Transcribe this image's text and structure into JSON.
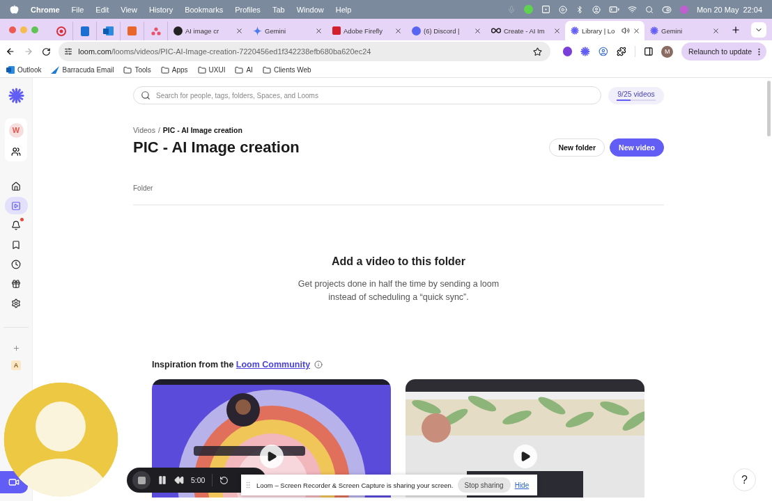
{
  "menu_bar": {
    "app": "Chrome",
    "menus": [
      "File",
      "Edit",
      "View",
      "History",
      "Bookmarks",
      "Profiles",
      "Tab",
      "Window",
      "Help"
    ],
    "date": "Mon 20 May",
    "time": "22:04"
  },
  "tabs": [
    {
      "kind": "pinned",
      "selected": false
    },
    {
      "kind": "pinned",
      "selected": false
    },
    {
      "kind": "pinned",
      "selected": false
    },
    {
      "kind": "pinned",
      "selected": false
    },
    {
      "kind": "pinned",
      "selected": false
    },
    {
      "kind": "normal",
      "title": "AI image cr",
      "selected": false,
      "audio": false
    },
    {
      "kind": "normal",
      "title": "Gemini",
      "selected": false,
      "audio": false
    },
    {
      "kind": "normal",
      "title": "Adobe Firefly",
      "selected": false,
      "audio": false
    },
    {
      "kind": "normal",
      "title": "(6) Discord |",
      "selected": false,
      "audio": false
    },
    {
      "kind": "normal",
      "title": "Create - AI Im",
      "selected": false,
      "audio": false
    },
    {
      "kind": "normal",
      "title": "Library | Lo",
      "selected": true,
      "audio": true
    },
    {
      "kind": "normal",
      "title": "Gemini",
      "selected": false,
      "audio": false
    }
  ],
  "address_bar": {
    "host": "loom.com",
    "path": "/looms/videos/PIC-AI-Image-creation-7220456ed1f342238efb680ba620ec24",
    "profile": "M",
    "relaunch": "Relaunch to update"
  },
  "bookmarks": [
    {
      "kind": "link",
      "label": "Outlook"
    },
    {
      "kind": "link",
      "label": "Barracuda Email"
    },
    {
      "kind": "folder",
      "label": "Tools"
    },
    {
      "kind": "folder",
      "label": "Apps"
    },
    {
      "kind": "folder",
      "label": "UXUI"
    },
    {
      "kind": "folder",
      "label": "AI"
    },
    {
      "kind": "folder",
      "label": "Clients Web"
    }
  ],
  "sidebar": {
    "workspace": "W",
    "nav": [
      {
        "selected": false,
        "badge": false
      },
      {
        "selected": true,
        "badge": false
      },
      {
        "selected": false,
        "badge": true
      },
      {
        "selected": false,
        "badge": false
      },
      {
        "selected": false,
        "badge": false
      },
      {
        "selected": false,
        "badge": false
      },
      {
        "selected": false,
        "badge": false
      }
    ],
    "other_workspace": "A"
  },
  "search": {
    "placeholder": "Search for people, tags, folders, Spaces, and Looms"
  },
  "usage": {
    "label": "9/25 videos",
    "level": 0.36
  },
  "breadcrumb": {
    "parent": "Videos",
    "separator": "/",
    "current": "PIC - AI Image creation"
  },
  "title": "PIC - AI Image creation",
  "actions": [
    "New folder",
    "New video"
  ],
  "section_label": "Folder",
  "empty_state": {
    "title": "Add a video to this folder",
    "text": "Get projects done in half the time by sending a loom instead of scheduling a “quick sync”."
  },
  "inspiration": {
    "text": "Inspiration from the ",
    "link": "Loom Community"
  },
  "recorder": {
    "time": "5:00"
  },
  "sharing": {
    "text": "Loom – Screen Recorder & Screen Capture is sharing your screen.",
    "stop": "Stop sharing",
    "hide": "Hide"
  },
  "help": "?"
}
